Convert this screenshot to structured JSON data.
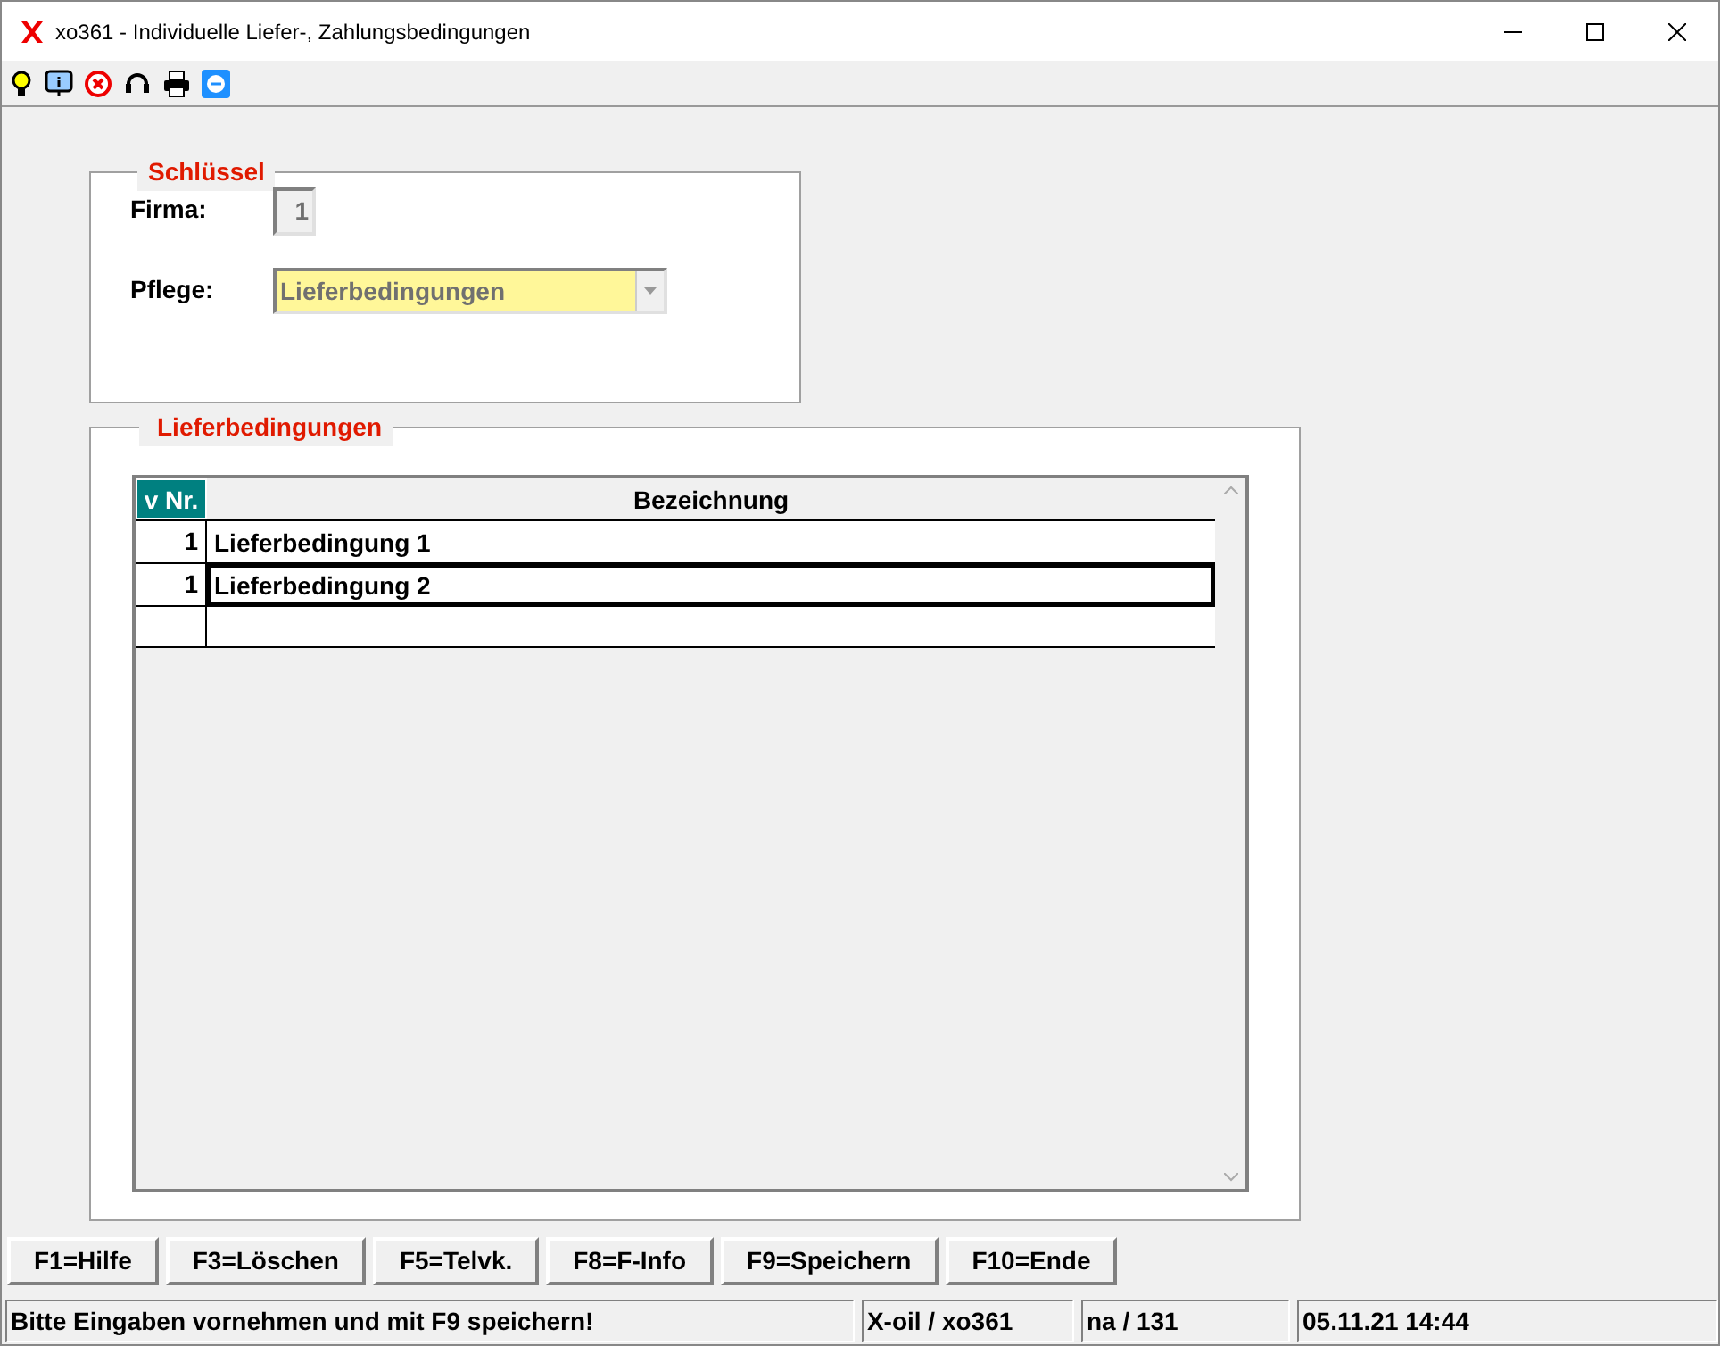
{
  "window": {
    "title": "xo361 - Individuelle Liefer-, Zahlungsbedingungen"
  },
  "key_group": {
    "title": "Schlüssel",
    "firma_label": "Firma:",
    "firma_value": "1",
    "pflege_label": "Pflege:",
    "pflege_value": "Lieferbedingungen"
  },
  "list_group": {
    "title": "Lieferbedingungen",
    "table": {
      "columns": [
        {
          "label": "v Nr.",
          "sorted": true
        },
        {
          "label": "Bezeichnung",
          "sorted": false
        }
      ],
      "rows": [
        {
          "nr": "1",
          "bezeichnung": "Lieferbedingung 1",
          "selected": false
        },
        {
          "nr": "1",
          "bezeichnung": "Lieferbedingung 2",
          "selected": true
        }
      ]
    }
  },
  "buttons": [
    "F1=Hilfe",
    "F3=Löschen",
    "F5=Telvk.",
    "F8=F-Info",
    "F9=Speichern",
    "F10=Ende"
  ],
  "status_bar": [
    "Bitte Eingaben vornehmen und mit F9 speichern!",
    "X-oil / xo361",
    "na / 131",
    "05.11.21 14:44"
  ]
}
